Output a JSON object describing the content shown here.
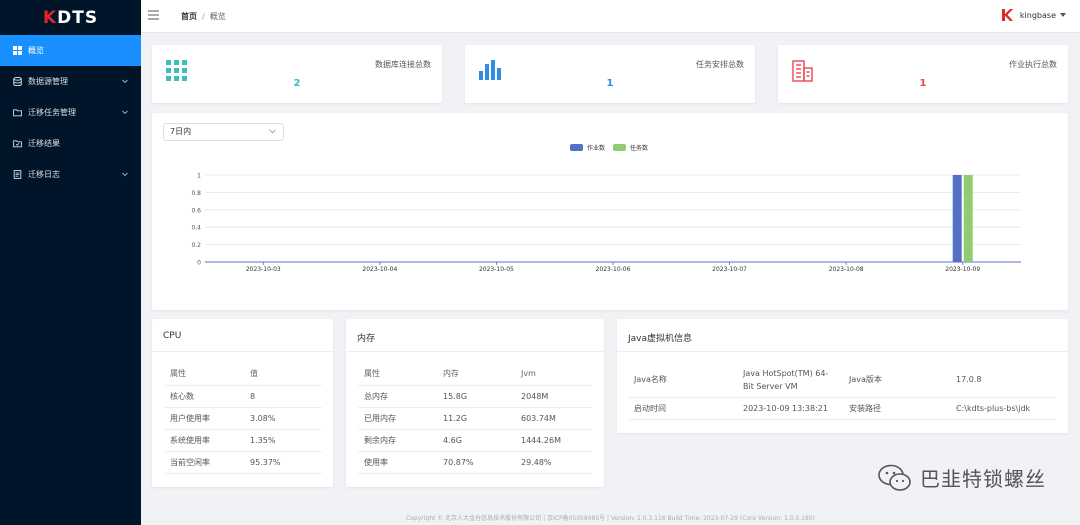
{
  "app": {
    "logo_k": "K",
    "logo_rest": "DTS"
  },
  "sidebar": {
    "items": [
      {
        "label": "概览",
        "icon": "grid-icon",
        "active": true
      },
      {
        "label": "数据源管理",
        "icon": "database-icon"
      },
      {
        "label": "迁移任务管理",
        "icon": "folder-icon"
      },
      {
        "label": "迁移结果",
        "icon": "folder-check-icon"
      },
      {
        "label": "迁移日志",
        "icon": "document-icon"
      }
    ]
  },
  "header": {
    "breadcrumb_home": "首页",
    "breadcrumb_sep": "/",
    "breadcrumb_current": "概览",
    "username": "kingbase"
  },
  "stats": [
    {
      "label": "数据库连接总数",
      "value": "2",
      "color": "#3dbfbb",
      "icon": "grid-icon"
    },
    {
      "label": "任务安排总数",
      "value": "1",
      "color": "#2f8de4",
      "icon": "bar-chart-icon"
    },
    {
      "label": "作业执行总数",
      "value": "1",
      "color": "#e8464f",
      "icon": "building-icon"
    }
  ],
  "filter": {
    "selected": "7日内"
  },
  "chart_data": {
    "type": "bar",
    "categories": [
      "2023-10-03",
      "2023-10-04",
      "2023-10-05",
      "2023-10-06",
      "2023-10-07",
      "2023-10-08",
      "2023-10-09"
    ],
    "series": [
      {
        "name": "作业数",
        "values": [
          0,
          0,
          0,
          0,
          0,
          0,
          1
        ],
        "color": "#5470c6"
      },
      {
        "name": "任务数",
        "values": [
          0,
          0,
          0,
          0,
          0,
          0,
          1
        ],
        "color": "#91cc75"
      }
    ],
    "yticks": [
      "0",
      "0.2",
      "0.4",
      "0.6",
      "0.8",
      "1"
    ],
    "ylim": [
      0,
      1
    ],
    "grid": true,
    "legend": "top-center"
  },
  "cpu": {
    "title": "CPU",
    "headers": [
      "属性",
      "值"
    ],
    "rows": [
      [
        "核心数",
        "8"
      ],
      [
        "用户使用率",
        "3.08%"
      ],
      [
        "系统使用率",
        "1.35%"
      ],
      [
        "当前空闲率",
        "95.37%"
      ]
    ]
  },
  "memory": {
    "title": "内存",
    "headers": [
      "属性",
      "内存",
      "Jvm"
    ],
    "rows": [
      [
        "总内存",
        "15.8G",
        "2048M"
      ],
      [
        "已用内存",
        "11.2G",
        "603.74M"
      ],
      [
        "剩余内存",
        "4.6G",
        "1444.26M"
      ],
      [
        "使用率",
        "70.87%",
        "29.48%"
      ]
    ]
  },
  "jvm": {
    "title": "Java虚拟机信息",
    "rows": [
      [
        "Java名称",
        "Java HotSpot(TM) 64-Bit Server VM",
        "Java版本",
        "17.0.8"
      ],
      [
        "启动时间",
        "2023-10-09 13:38:21",
        "安装路径",
        "C:\\kdts-plus-bs\\jdk"
      ]
    ]
  },
  "footer": "Copyright © 北京人大金仓信息技术股份有限公司 | 京ICP备05058485号 | Version: 1.0.3.116 Build Time: 2023-07-29 (Core Version: 1.0.5.180)",
  "watermark": "巴韭特锁螺丝"
}
